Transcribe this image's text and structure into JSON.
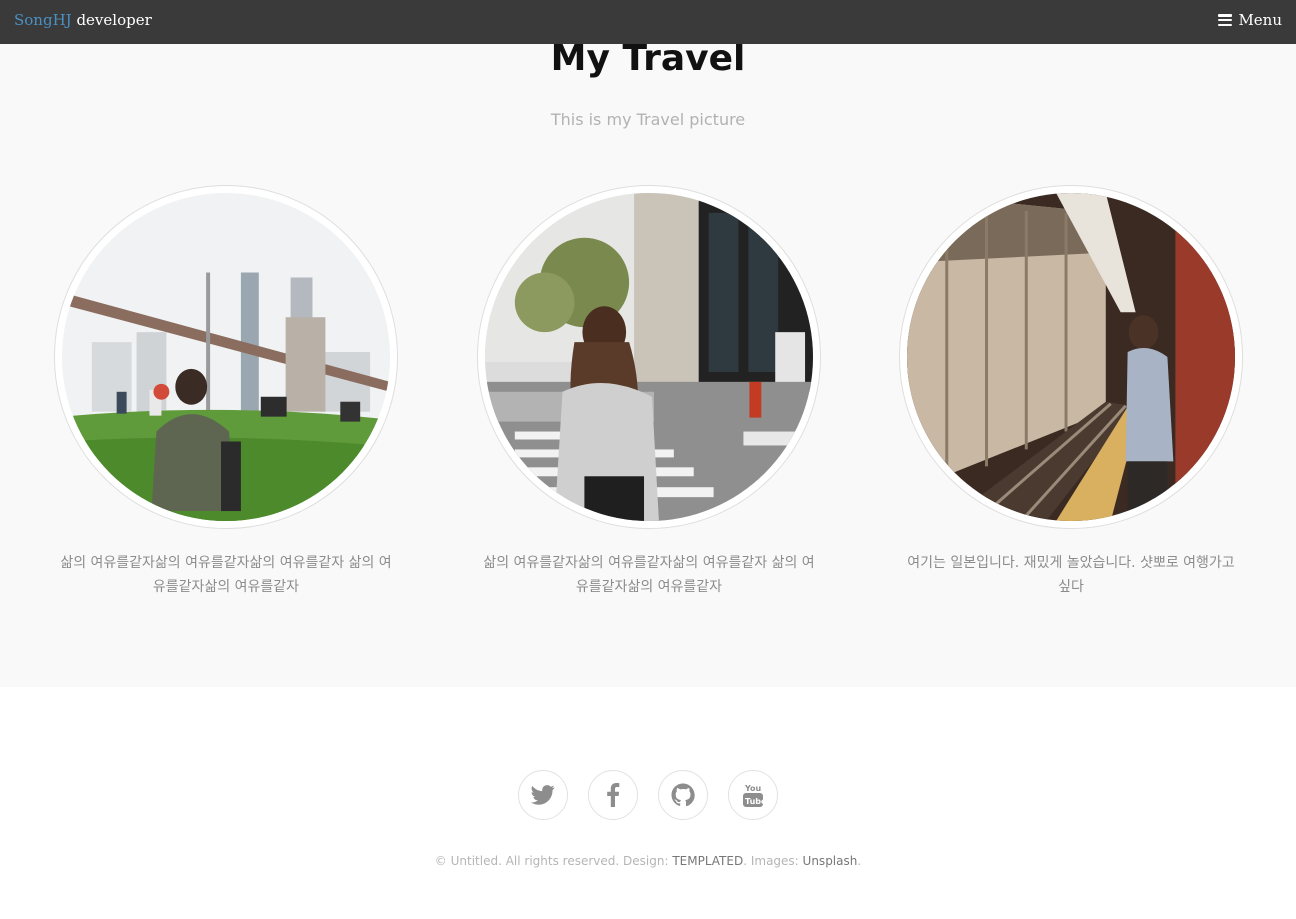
{
  "header": {
    "brand": "SongHJ",
    "role": "developer",
    "menu_label": "Menu",
    "brand_color": "#4a90c2",
    "bar_color": "#3a3a3a"
  },
  "main": {
    "title": "My Travel",
    "subtitle": "This is my Travel picture",
    "cards": [
      {
        "photo": "brooklyn-bridge-park-photo",
        "caption": "삶의 여유를같자삶의 여유를같자삶의 여유를같자 삶의 여유를같자삶의 여유를같자"
      },
      {
        "photo": "street-crosswalk-woman-photo",
        "caption": "삶의 여유를같자삶의 여유를같자삶의 여유를같자 삶의 여유를같자삶의 여유를같자"
      },
      {
        "photo": "subway-platform-man-photo",
        "caption": "여기는 일본입니다. 재밌게 놀았습니다. 샷뽀로 여행가고싶다"
      }
    ]
  },
  "footer": {
    "socials": [
      {
        "name": "twitter-icon"
      },
      {
        "name": "facebook-icon"
      },
      {
        "name": "github-icon"
      },
      {
        "name": "youtube-icon"
      }
    ],
    "copyright_prefix": "© Untitled. All rights reserved. Design: ",
    "design_link": "TEMPLATED",
    "images_prefix": ". Images: ",
    "images_link": "Unsplash",
    "suffix": "."
  }
}
